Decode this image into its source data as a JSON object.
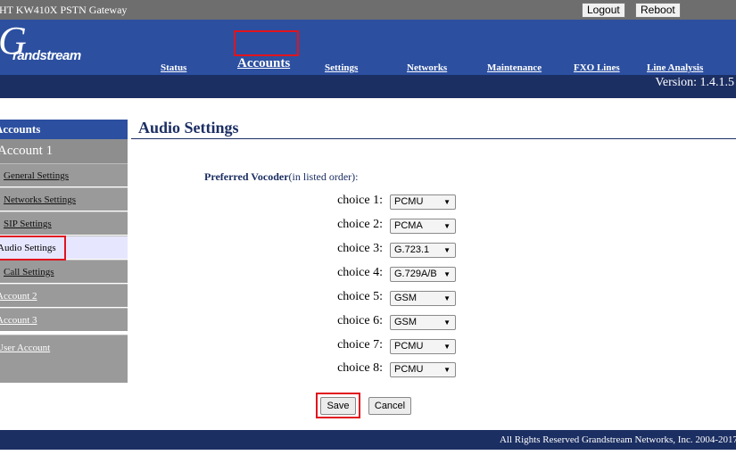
{
  "window": {
    "title": "HT KW410X PSTN Gateway"
  },
  "topbar": {
    "logout_label": "Logout",
    "reboot_label": "Reboot"
  },
  "header": {
    "logo_letter": "G",
    "logo_rest": "randstream",
    "nav": [
      {
        "label": "Status"
      },
      {
        "label": "Accounts",
        "active": true
      },
      {
        "label": "Settings"
      },
      {
        "label": "Networks"
      },
      {
        "label": "Maintenance"
      },
      {
        "label": "FXO Lines"
      },
      {
        "label": "Line Analysis"
      }
    ],
    "version": "Version: 1.4.1.5"
  },
  "sidebar": {
    "heading": "Accounts",
    "account_label": "Account 1",
    "items": [
      {
        "label": "General Settings"
      },
      {
        "label": "Networks Settings"
      },
      {
        "label": "SIP Settings"
      },
      {
        "label": "Audio Settings",
        "active": true
      },
      {
        "label": "Call Settings"
      },
      {
        "label": "Account 2"
      },
      {
        "label": "Account 3"
      },
      {
        "label": "User Account"
      }
    ]
  },
  "main": {
    "title": "Audio Settings",
    "vocoder_label_bold": "Preferred Vocoder",
    "vocoder_label_rest": "(in listed order):",
    "choices": [
      {
        "label": "choice 1:",
        "value": "PCMU"
      },
      {
        "label": "choice 2:",
        "value": "PCMA"
      },
      {
        "label": "choice 3:",
        "value": "G.723.1"
      },
      {
        "label": "choice 4:",
        "value": "G.729A/B"
      },
      {
        "label": "choice 5:",
        "value": "GSM"
      },
      {
        "label": "choice 6:",
        "value": "GSM"
      },
      {
        "label": "choice 7:",
        "value": "PCMU"
      },
      {
        "label": "choice 8:",
        "value": "PCMU"
      }
    ],
    "save_label": "Save",
    "cancel_label": "Cancel"
  },
  "footer": {
    "copyright": "All Rights Reserved Grandstream Networks, Inc. 2004-2017"
  },
  "colors": {
    "header": "#2c4fa0",
    "navy": "#1c2f63",
    "highlight": "#e0141e",
    "sidebar": "#9a9a9a"
  }
}
